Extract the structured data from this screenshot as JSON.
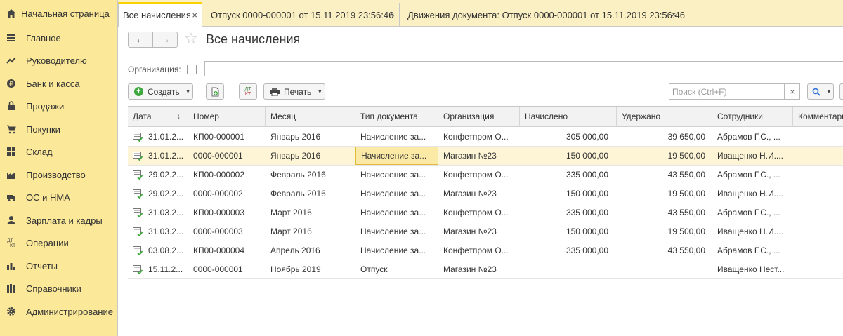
{
  "tabs": {
    "home": "Начальная страница",
    "active": "Все начисления",
    "tab2": "Отпуск 0000-000001 от 15.11.2019 23:56:46",
    "tab3": "Движения документа: Отпуск 0000-000001 от 15.11.2019 23:56:46",
    "close_glyph": "×"
  },
  "sidebar": {
    "items": [
      {
        "label": "Главное",
        "icon": "menu-lines-icon"
      },
      {
        "label": "Руководителю",
        "icon": "trend-up-icon"
      },
      {
        "label": "Банк и касса",
        "icon": "ruble-coin-icon"
      },
      {
        "label": "Продажи",
        "icon": "shopping-bag-icon"
      },
      {
        "label": "Покупки",
        "icon": "cart-icon"
      },
      {
        "label": "Склад",
        "icon": "warehouse-grid-icon"
      },
      {
        "label": "Производство",
        "icon": "factory-icon"
      },
      {
        "label": "ОС и НМА",
        "icon": "truck-icon"
      },
      {
        "label": "Зарплата и кадры",
        "icon": "person-icon"
      },
      {
        "label": "Операции",
        "icon": "dt-kt-icon"
      },
      {
        "label": "Отчеты",
        "icon": "bar-chart-icon"
      },
      {
        "label": "Справочники",
        "icon": "books-icon"
      },
      {
        "label": "Администрирование",
        "icon": "gear-icon"
      }
    ]
  },
  "header": {
    "back": "←",
    "forward": "→",
    "star": "☆",
    "title": "Все начисления"
  },
  "filter": {
    "org_label": "Организация:"
  },
  "toolbar": {
    "create_label": "Создать",
    "dt_label": "ДТ",
    "kt_label": "КТ",
    "print_label": "Печать",
    "caret": "▼",
    "search_placeholder": "Поиск (Ctrl+F)",
    "search_clear": "×"
  },
  "table": {
    "columns": [
      "Дата",
      "Номер",
      "Месяц",
      "Тип документа",
      "Организация",
      "Начислено",
      "Удержано",
      "Сотрудники",
      "Комментарий"
    ],
    "sort_glyph": "↓",
    "rows": [
      {
        "date": "31.01.2...",
        "number": "КП00-000001",
        "month": "Январь 2016",
        "type": "Начисление за...",
        "org": "Конфетпром О...",
        "accrued": "305 000,00",
        "withheld": "39 650,00",
        "employees": "Абрамов Г.С., ..."
      },
      {
        "date": "31.01.2...",
        "number": "0000-000001",
        "month": "Январь 2016",
        "type": "Начисление за...",
        "org": "Магазин №23",
        "accrued": "150 000,00",
        "withheld": "19 500,00",
        "employees": "Иващенко Н.И...."
      },
      {
        "date": "29.02.2...",
        "number": "КП00-000002",
        "month": "Февраль 2016",
        "type": "Начисление за...",
        "org": "Конфетпром О...",
        "accrued": "335 000,00",
        "withheld": "43 550,00",
        "employees": "Абрамов Г.С., ..."
      },
      {
        "date": "29.02.2...",
        "number": "0000-000002",
        "month": "Февраль 2016",
        "type": "Начисление за...",
        "org": "Магазин №23",
        "accrued": "150 000,00",
        "withheld": "19 500,00",
        "employees": "Иващенко Н.И...."
      },
      {
        "date": "31.03.2...",
        "number": "КП00-000003",
        "month": "Март 2016",
        "type": "Начисление за...",
        "org": "Конфетпром О...",
        "accrued": "335 000,00",
        "withheld": "43 550,00",
        "employees": "Абрамов Г.С., ..."
      },
      {
        "date": "31.03.2...",
        "number": "0000-000003",
        "month": "Март 2016",
        "type": "Начисление за...",
        "org": "Магазин №23",
        "accrued": "150 000,00",
        "withheld": "19 500,00",
        "employees": "Иващенко Н.И...."
      },
      {
        "date": "03.08.2...",
        "number": "КП00-000004",
        "month": "Апрель 2016",
        "type": "Начисление за...",
        "org": "Конфетпром О...",
        "accrued": "335 000,00",
        "withheld": "43 550,00",
        "employees": "Абрамов Г.С., ..."
      },
      {
        "date": "15.11.2...",
        "number": "0000-000001",
        "month": "Ноябрь 2019",
        "type": "Отпуск",
        "org": "Магазин №23",
        "accrued": "",
        "withheld": "",
        "employees": "Иващенко Нест..."
      }
    ]
  },
  "colors": {
    "sidebar_bg": "#fbe898",
    "tabbar_bg": "#fbf0c3",
    "selected_row": "#fdf5d6",
    "current_cell": "#fbe9a6",
    "accent_green": "#3ea83e"
  }
}
